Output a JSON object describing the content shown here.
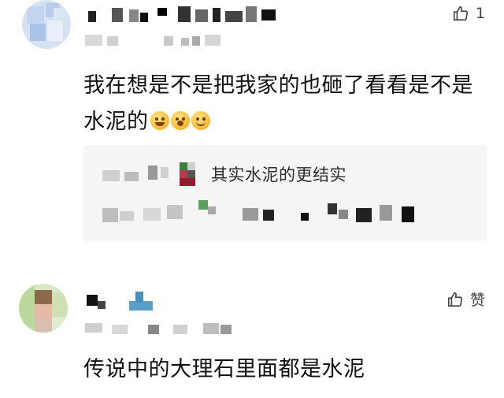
{
  "comments": [
    {
      "like_count": "1",
      "like_icon": "thumb-up-icon",
      "text": "我在想是不是把我家的也砸了看看是不是水泥的",
      "emojis": [
        "grinning-emoji",
        "yawning-emoji",
        "smiling-emoji"
      ],
      "reply": {
        "text": "其实水泥的更结实"
      }
    },
    {
      "like_label": "赞",
      "like_icon": "thumb-up-icon",
      "text": "传说中的大理石里面都是水泥"
    }
  ],
  "colors": {
    "avatar1": "#c8d8ef",
    "avatar2": "#cfe6b8",
    "reply_bg": "#f5f5f5",
    "text": "#111111"
  }
}
